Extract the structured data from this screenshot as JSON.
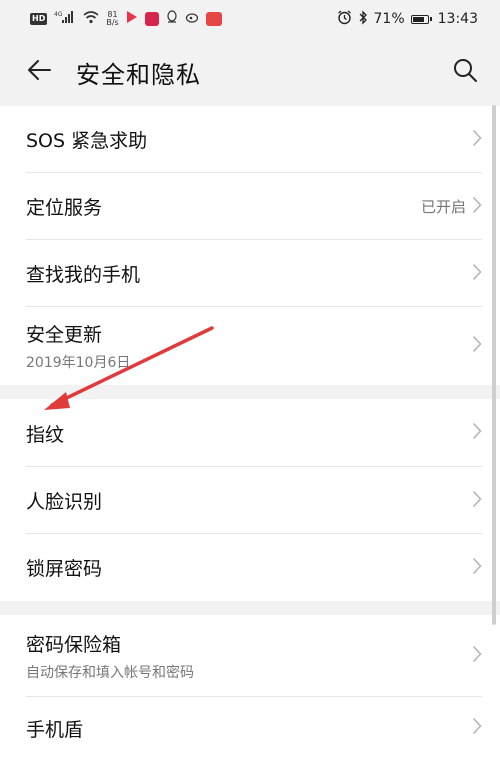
{
  "status_bar": {
    "hd": "HD",
    "signal": "4G",
    "net_speed_value": "81",
    "net_speed_unit": "B/s",
    "battery": "71%",
    "time": "13:43"
  },
  "header": {
    "title": "安全和隐私"
  },
  "groups": [
    {
      "items": [
        {
          "label": "SOS 紧急求助"
        },
        {
          "label": "定位服务",
          "value": "已开启"
        },
        {
          "label": "查找我的手机"
        },
        {
          "label": "安全更新",
          "sub": "2019年10月6日"
        }
      ]
    },
    {
      "items": [
        {
          "label": "指纹"
        },
        {
          "label": "人脸识别"
        },
        {
          "label": "锁屏密码"
        }
      ]
    },
    {
      "items": [
        {
          "label": "密码保险箱",
          "sub": "自动保存和填入帐号和密码"
        },
        {
          "label": "手机盾"
        }
      ]
    }
  ],
  "colors": {
    "background": "#f2f2f2",
    "card": "#ffffff",
    "annotation_arrow": "#e03a3a"
  }
}
